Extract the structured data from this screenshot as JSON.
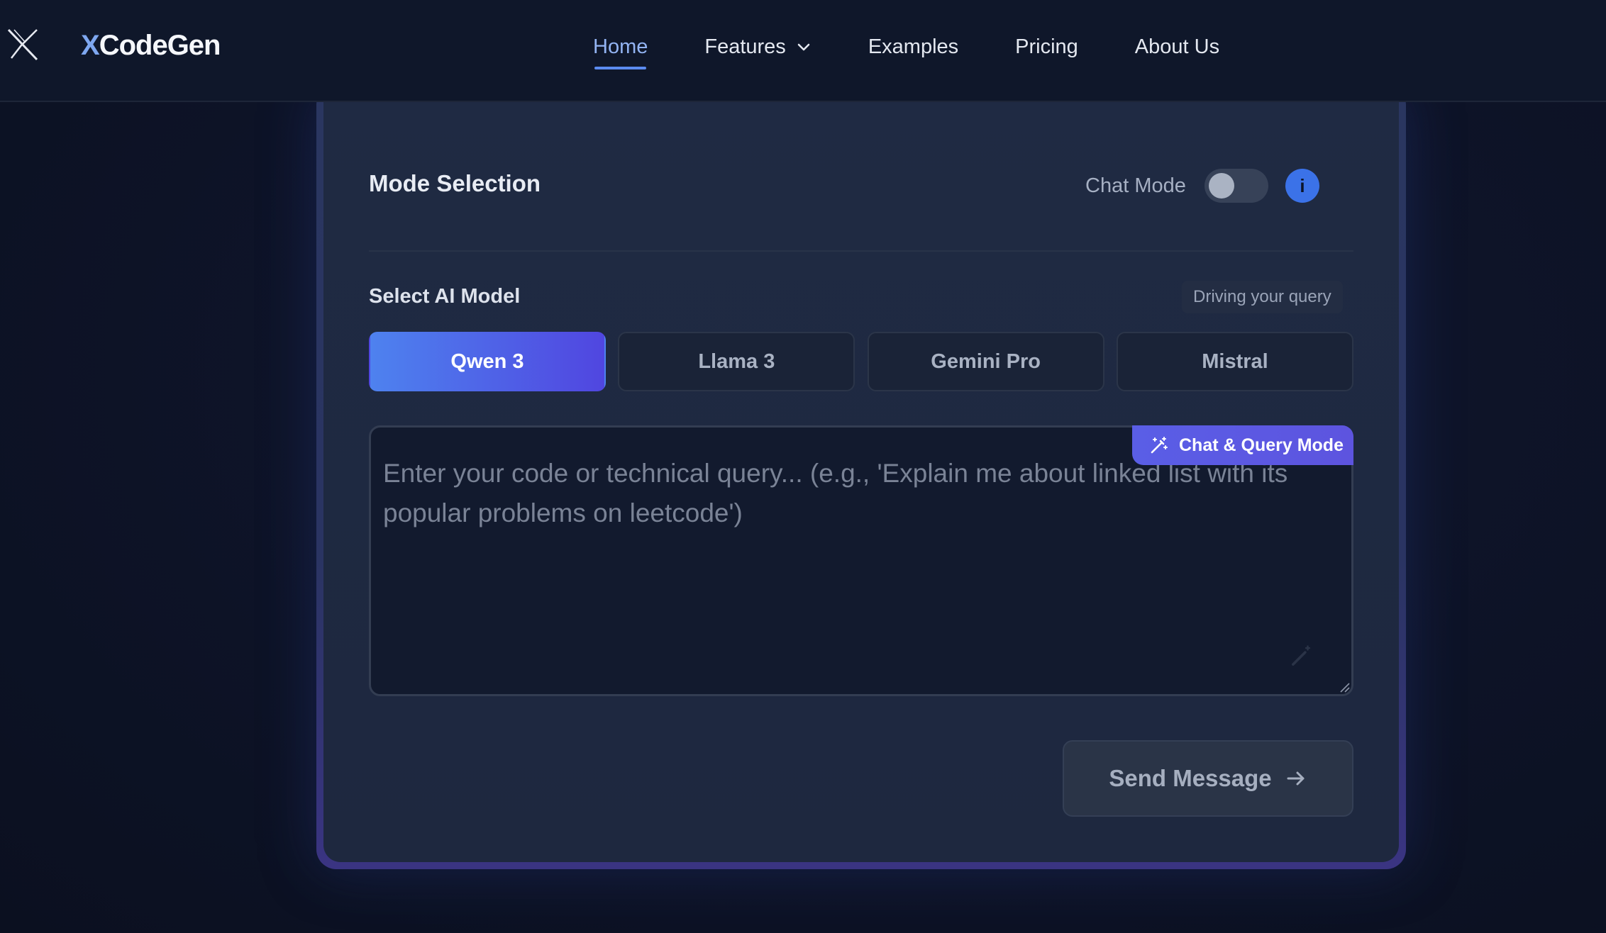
{
  "nav": {
    "brand_accent": "X",
    "brand_rest": "CodeGen",
    "links": [
      {
        "label": "Home",
        "active": true
      },
      {
        "label": "Features",
        "has_dropdown": true
      },
      {
        "label": "Examples"
      },
      {
        "label": "Pricing"
      },
      {
        "label": "About Us"
      }
    ]
  },
  "mode": {
    "title": "Mode Selection",
    "chat_mode_label": "Chat Mode",
    "chat_mode_enabled": false,
    "info_glyph": "i"
  },
  "models": {
    "label": "Select AI Model",
    "hint": "Driving your query",
    "options": [
      "Qwen 3",
      "Llama 3",
      "Gemini Pro",
      "Mistral"
    ],
    "selected": "Qwen 3"
  },
  "query": {
    "value": "",
    "placeholder": "Enter your code or technical query... (e.g., 'Explain me about linked list with its popular problems on leetcode')",
    "badge": "Chat & Query Mode"
  },
  "actions": {
    "send_label": "Send Message"
  },
  "icons": {
    "logo": "x-logo-icon",
    "dropdown": "chevron-down-icon",
    "badge": "magic-wand-icon",
    "send": "arrow-right-icon"
  },
  "colors": {
    "accent": "#5b8bf0",
    "selected_model_start": "#4e82ef",
    "selected_model_end": "#5046e0",
    "badge": "#5a5ee6",
    "info": "#3b72e8"
  }
}
